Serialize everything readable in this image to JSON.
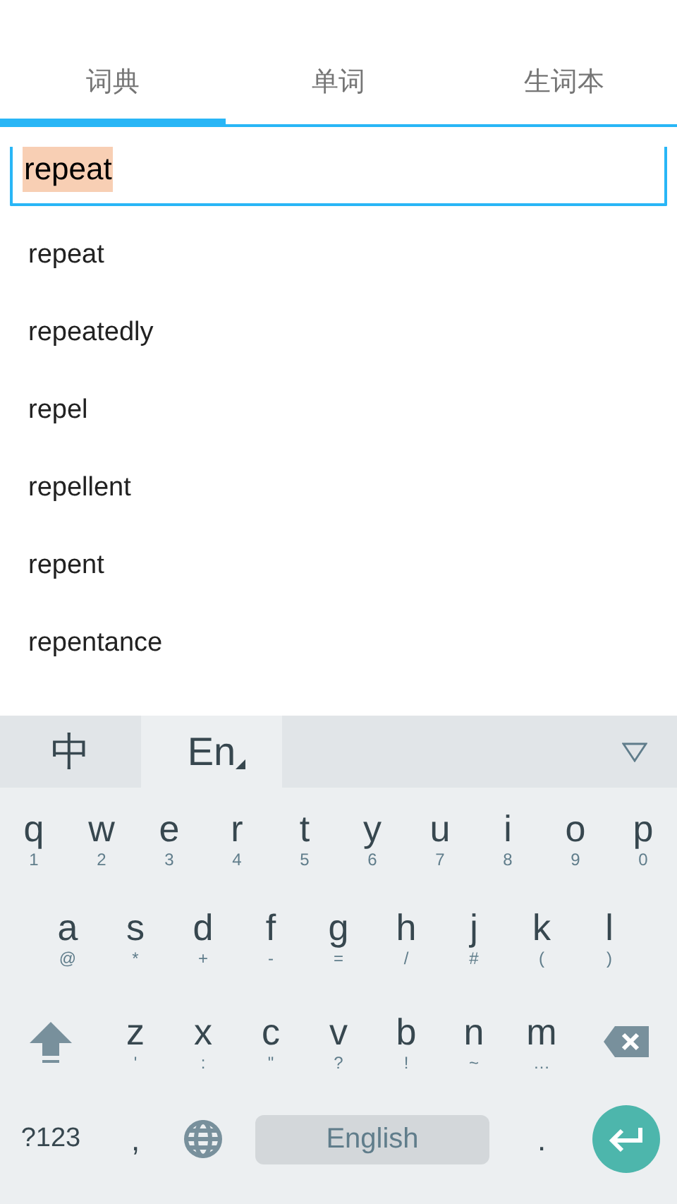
{
  "tabs": [
    {
      "label": "词典",
      "selected": true
    },
    {
      "label": "单词",
      "selected": false
    },
    {
      "label": "生词本",
      "selected": false
    }
  ],
  "search": {
    "value": "repeat",
    "text_selected": true
  },
  "suggestions": [
    "repeat",
    "repeatedly",
    "repel",
    "repellent",
    "repent",
    "repentance"
  ],
  "keyboard": {
    "languages": [
      {
        "label": "中",
        "selected": false
      },
      {
        "label": "En",
        "selected": true
      }
    ],
    "rows": [
      [
        {
          "key": "q",
          "hint": "1"
        },
        {
          "key": "w",
          "hint": "2"
        },
        {
          "key": "e",
          "hint": "3"
        },
        {
          "key": "r",
          "hint": "4"
        },
        {
          "key": "t",
          "hint": "5"
        },
        {
          "key": "y",
          "hint": "6"
        },
        {
          "key": "u",
          "hint": "7"
        },
        {
          "key": "i",
          "hint": "8"
        },
        {
          "key": "o",
          "hint": "9"
        },
        {
          "key": "p",
          "hint": "0"
        }
      ],
      [
        {
          "key": "a",
          "hint": "@"
        },
        {
          "key": "s",
          "hint": "*"
        },
        {
          "key": "d",
          "hint": "+"
        },
        {
          "key": "f",
          "hint": "-"
        },
        {
          "key": "g",
          "hint": "="
        },
        {
          "key": "h",
          "hint": "/"
        },
        {
          "key": "j",
          "hint": "#"
        },
        {
          "key": "k",
          "hint": "("
        },
        {
          "key": "l",
          "hint": ")"
        }
      ],
      [
        {
          "key": "z",
          "hint": "'"
        },
        {
          "key": "x",
          "hint": ":"
        },
        {
          "key": "c",
          "hint": "\""
        },
        {
          "key": "v",
          "hint": "?"
        },
        {
          "key": "b",
          "hint": "!"
        },
        {
          "key": "n",
          "hint": "~"
        },
        {
          "key": "m",
          "hint": "…"
        }
      ]
    ],
    "symbols_key": "?123",
    "comma_key": ",",
    "space_label": "English",
    "period_key": "."
  }
}
